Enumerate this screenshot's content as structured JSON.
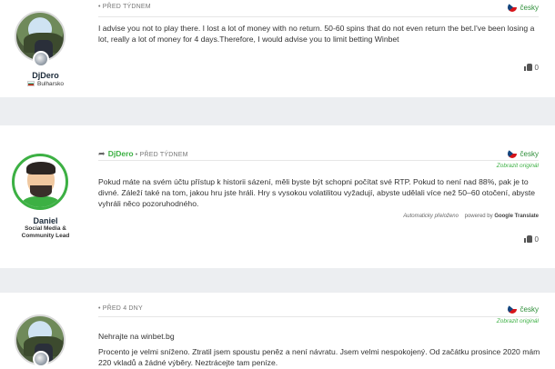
{
  "posts": [
    {
      "time": "PŘED TÝDNEM",
      "user": {
        "name": "DjDero",
        "country": "Bulharsko"
      },
      "lang": "česky",
      "text": "I advise you not to play there. I lost a lot of money with no return. 50-60 spins that do not even return the bet.I've been losing a lot, really a lot of money for 4 days.Therefore, I would advise you to limit betting Winbet",
      "likes": "0"
    },
    {
      "reply_to": "DjDero",
      "time": "PŘED TÝDNEM",
      "user": {
        "name": "Daniel",
        "role": "Social Media & Community Lead"
      },
      "lang": "česky",
      "show_original": "Zobrazit originál",
      "text": "Pokud máte na svém účtu přístup k historii sázení, měli byste být schopni počítat své RTP. Pokud to není nad 88%, pak je to divné. Záleží také na tom, jakou hru jste hráli. Hry s vysokou volatilitou vyžadují, abyste udělali více než 50–60 otočení, abyste vyhráli něco pozoruhodného.",
      "auto_translated": "Automaticky přeloženo",
      "powered_by": "powered by",
      "google_translate": "Google Translate",
      "likes": "0"
    },
    {
      "time": "PŘED 4 DNY",
      "lang": "česky",
      "show_original": "Zobrazit originál",
      "title": "Nehrajte na winbet.bg",
      "text": "Procento je velmi sníženo. Ztratil jsem spoustu peněz a není návratu. Jsem velmi nespokojený. Od začátku prosince 2020 mám 220 vkladů a žádné výběry. Neztrácejte tam peníze."
    }
  ],
  "colors": {
    "accent": "#3cb043",
    "background": "#eceef1"
  },
  "icons": [
    "thumbs-up-icon",
    "reply-arrow-icon",
    "czech-flag-icon",
    "bulgaria-flag-icon",
    "rank-badge-icon"
  ]
}
